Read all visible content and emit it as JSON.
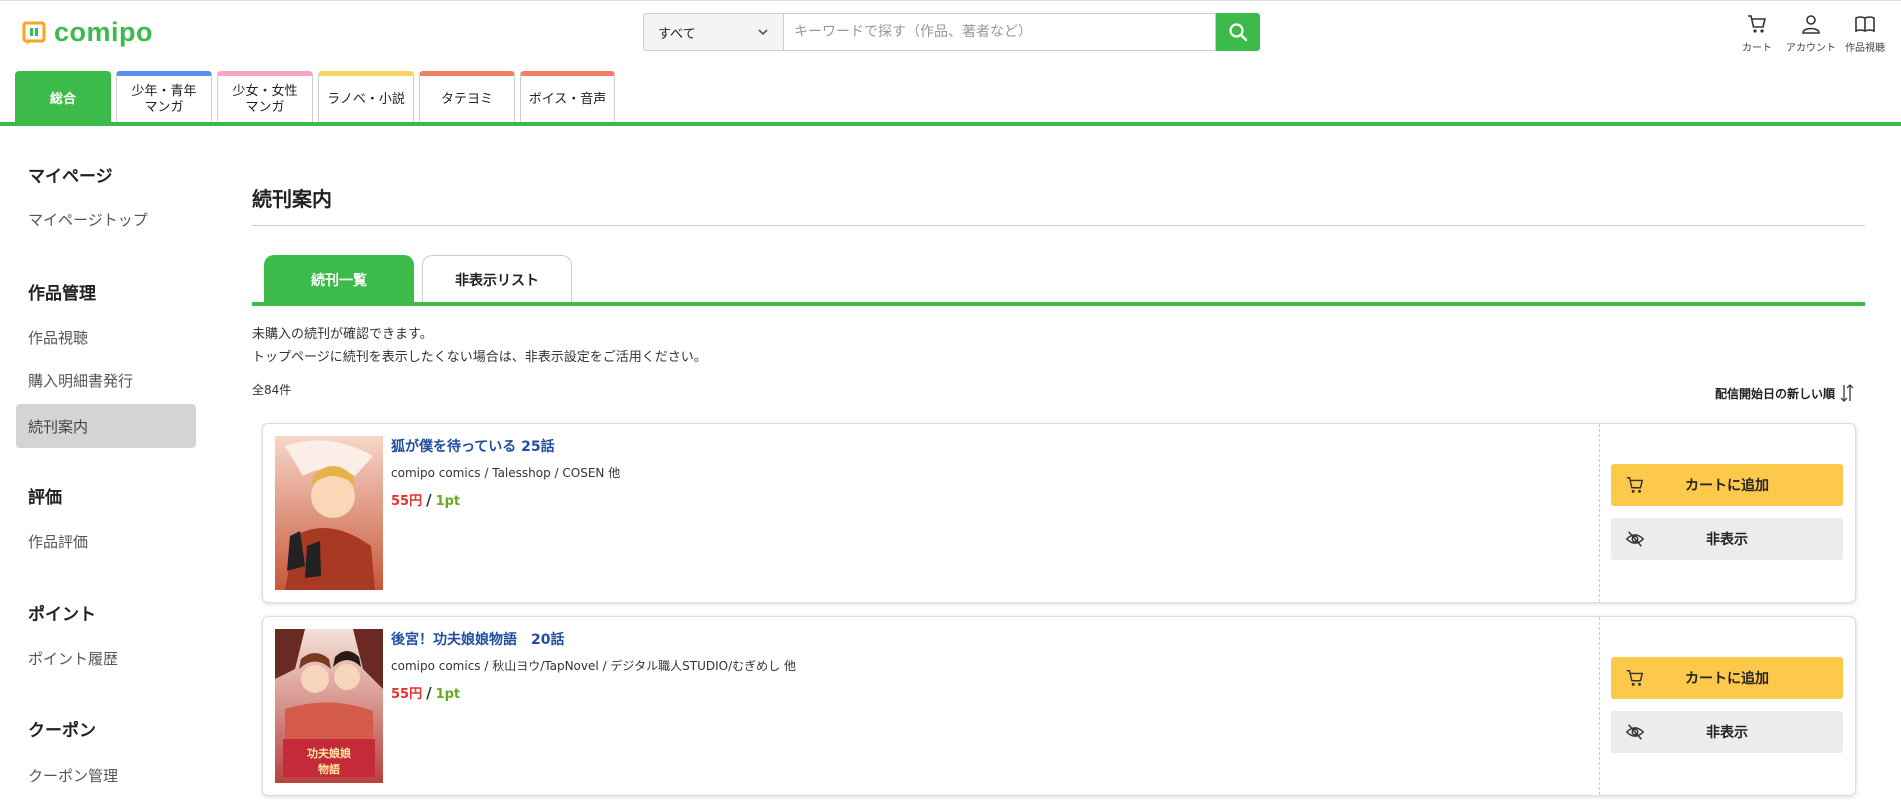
{
  "header": {
    "logo_text": "comipo",
    "search": {
      "category": "すべて",
      "placeholder": "キーワードで探す（作品、著者など）"
    },
    "icons": [
      {
        "icon": "cart-icon",
        "label": "カート"
      },
      {
        "icon": "account-icon",
        "label": "アカウント"
      },
      {
        "icon": "book-icon",
        "label": "作品視聴"
      }
    ],
    "nav_tabs": [
      {
        "label": "総合",
        "accent": "#3cba4a",
        "active": true
      },
      {
        "label": "少年・青年\nマンガ",
        "accent": "#5b8def"
      },
      {
        "label": "少女・女性\nマンガ",
        "accent": "#f5a3c7"
      },
      {
        "label": "ラノベ・小説",
        "accent": "#f7d560"
      },
      {
        "label": "タテヨミ",
        "accent": "#ef7f6b"
      },
      {
        "label": "ボイス・音声",
        "accent": "#ef7f6b"
      }
    ]
  },
  "sidebar": {
    "sections": [
      {
        "title": "マイページ",
        "items": [
          "マイページトップ"
        ]
      },
      {
        "title": "作品管理",
        "items": [
          "作品視聴",
          "購入明細書発行",
          "続刊案内"
        ]
      },
      {
        "title": "評価",
        "items": [
          "作品評価"
        ]
      },
      {
        "title": "ポイント",
        "items": [
          "ポイント履歴"
        ]
      },
      {
        "title": "クーポン",
        "items": [
          "クーポン管理"
        ]
      }
    ],
    "active_item": "続刊案内"
  },
  "main": {
    "title": "続刊案内",
    "tabs": [
      {
        "label": "続刊一覧",
        "active": true
      },
      {
        "label": "非表示リスト"
      }
    ],
    "desc_line1": "未購入の続刊が確認できます。",
    "desc_line2": "トップページに続刊を表示したくない場合は、非表示設定をご活用ください。",
    "count": "全84件",
    "sort_label": "配信開始日の新しい順",
    "items": [
      {
        "title": "狐が僕を待っている 25話",
        "authors": "comipo comics / Talesshop / COSEN 他",
        "price": "55円",
        "points": "1pt",
        "cart_label": "カートに追加",
        "hide_label": "非表示"
      },
      {
        "title": "後宮！功夫娘娘物語　20話",
        "authors": "comipo comics / 秋山ヨウ/TapNovel / デジタル職人STUDIO/むぎめし 他",
        "price": "55円",
        "points": "1pt",
        "cart_label": "カートに追加",
        "hide_label": "非表示"
      }
    ]
  }
}
